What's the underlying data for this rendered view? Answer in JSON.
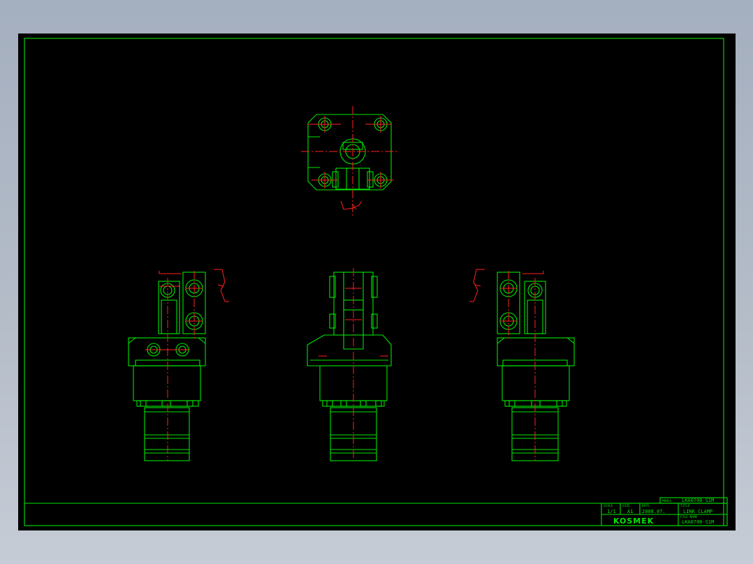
{
  "title_block": {
    "model_label": "MODEL",
    "model_value": "LKA0700-S1M",
    "title_label": "TITLE",
    "title_value": "LINK CLAMP",
    "scale_label": "SCALE",
    "scale_value": "1/1",
    "size_label": "SIZE",
    "size_value": "A1",
    "date_label": "DATE",
    "date_value": "2008.07.",
    "file_label": "FILE NAME",
    "file_value": "LKA0700-S1M",
    "company": "KOSMEK"
  },
  "colors": {
    "background": "#000000",
    "outline": "#00e600",
    "centerline": "#ff2020",
    "desktop": "#b4bcc8"
  }
}
